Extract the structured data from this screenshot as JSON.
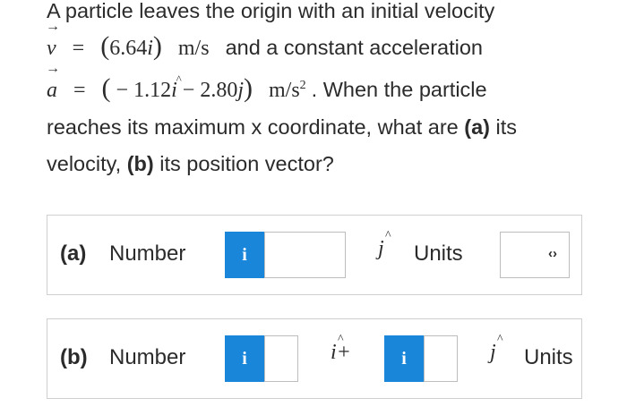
{
  "problem": {
    "line1": "A particle leaves the origin with an initial velocity",
    "v_symbol": "v",
    "equals": "=",
    "v_value": "6.64",
    "i_symbol": "i",
    "v_unit": "m/s",
    "v_tail": "and a constant acceleration",
    "a_symbol": "a",
    "a_minus": "−",
    "a_value1": "1.12",
    "a_minus2": "−",
    "a_value2": "2.80",
    "j_symbol": "j",
    "a_unit_base": "m/s",
    "a_unit_exp": "2",
    "a_tail": ". When the particle",
    "line4_text": "reaches its maximum x coordinate, what are ",
    "part_a": "(a)",
    "line4_tail": " its",
    "line5_head": "velocity, ",
    "part_b": "(b)",
    "line5_tail": " its position vector?"
  },
  "answer_a": {
    "part_label": "(a)",
    "number_label": "Number",
    "info_label": "i",
    "input_value": "",
    "unit_vector": "j",
    "units_label": "Units",
    "units_selected": ""
  },
  "answer_b": {
    "part_label": "(b)",
    "number_label": "Number",
    "info_label_1": "i",
    "input_value_1": "",
    "unit_vector_1": "i+",
    "info_label_2": "i",
    "input_value_2": "",
    "unit_vector_2": "j",
    "units_label": "Units"
  },
  "colors": {
    "info_button": "#1a86d9",
    "box_border": "#cfcfcf",
    "text": "#2b2b2b"
  },
  "icons": {
    "units_select": "chevron-up-down-icon"
  }
}
